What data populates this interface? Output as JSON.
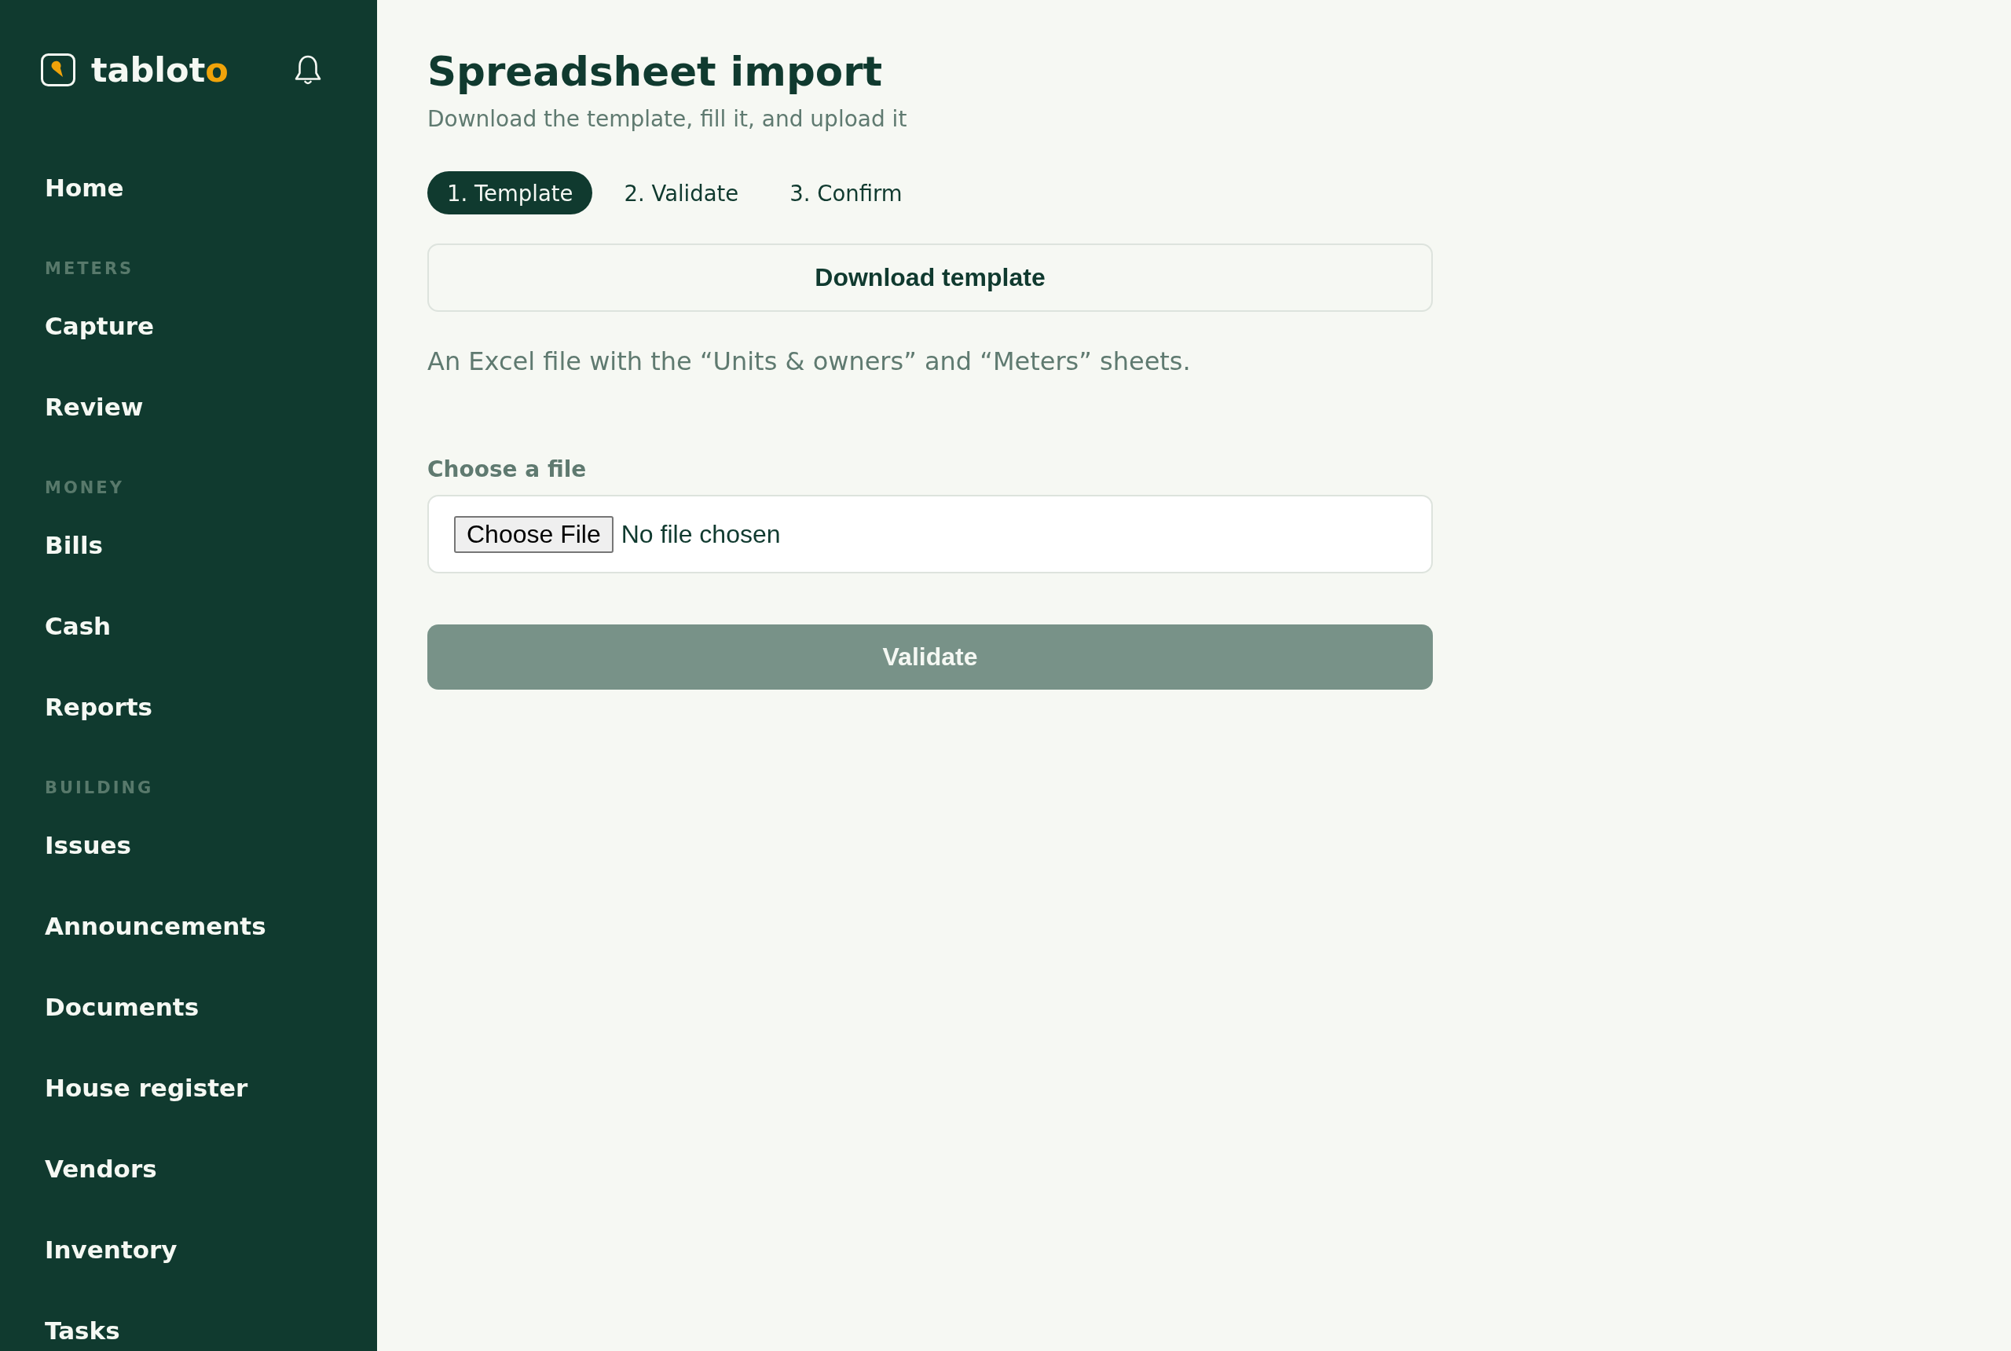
{
  "sidebar": {
    "logo": {
      "text": "tablot",
      "accent_text": "o"
    },
    "items": [
      {
        "kind": "link",
        "label": "Home"
      },
      {
        "kind": "section",
        "label": "METERS"
      },
      {
        "kind": "link",
        "label": "Capture"
      },
      {
        "kind": "link",
        "label": "Review"
      },
      {
        "kind": "section",
        "label": "MONEY"
      },
      {
        "kind": "link",
        "label": "Bills"
      },
      {
        "kind": "link",
        "label": "Cash"
      },
      {
        "kind": "link",
        "label": "Reports"
      },
      {
        "kind": "section",
        "label": "BUILDING"
      },
      {
        "kind": "link",
        "label": "Issues"
      },
      {
        "kind": "link",
        "label": "Announcements"
      },
      {
        "kind": "link",
        "label": "Documents"
      },
      {
        "kind": "link",
        "label": "House register"
      },
      {
        "kind": "link",
        "label": "Vendors"
      },
      {
        "kind": "link",
        "label": "Inventory"
      },
      {
        "kind": "link",
        "label": "Tasks"
      }
    ]
  },
  "page": {
    "title": "Spreadsheet import",
    "subtitle": "Download the template, fill it, and upload it"
  },
  "steps": [
    {
      "label": "1. Template",
      "selected": true
    },
    {
      "label": "2. Validate",
      "selected": false
    },
    {
      "label": "3. Confirm",
      "selected": false
    }
  ],
  "download_button": {
    "label": "Download template"
  },
  "description": "An Excel file with the “Units & owners” and “Meters” sheets.",
  "file_upload": {
    "label": "Choose a file",
    "button": "Choose File",
    "status": "No file chosen"
  },
  "validate_button": {
    "label": "Validate",
    "disabled": true
  }
}
